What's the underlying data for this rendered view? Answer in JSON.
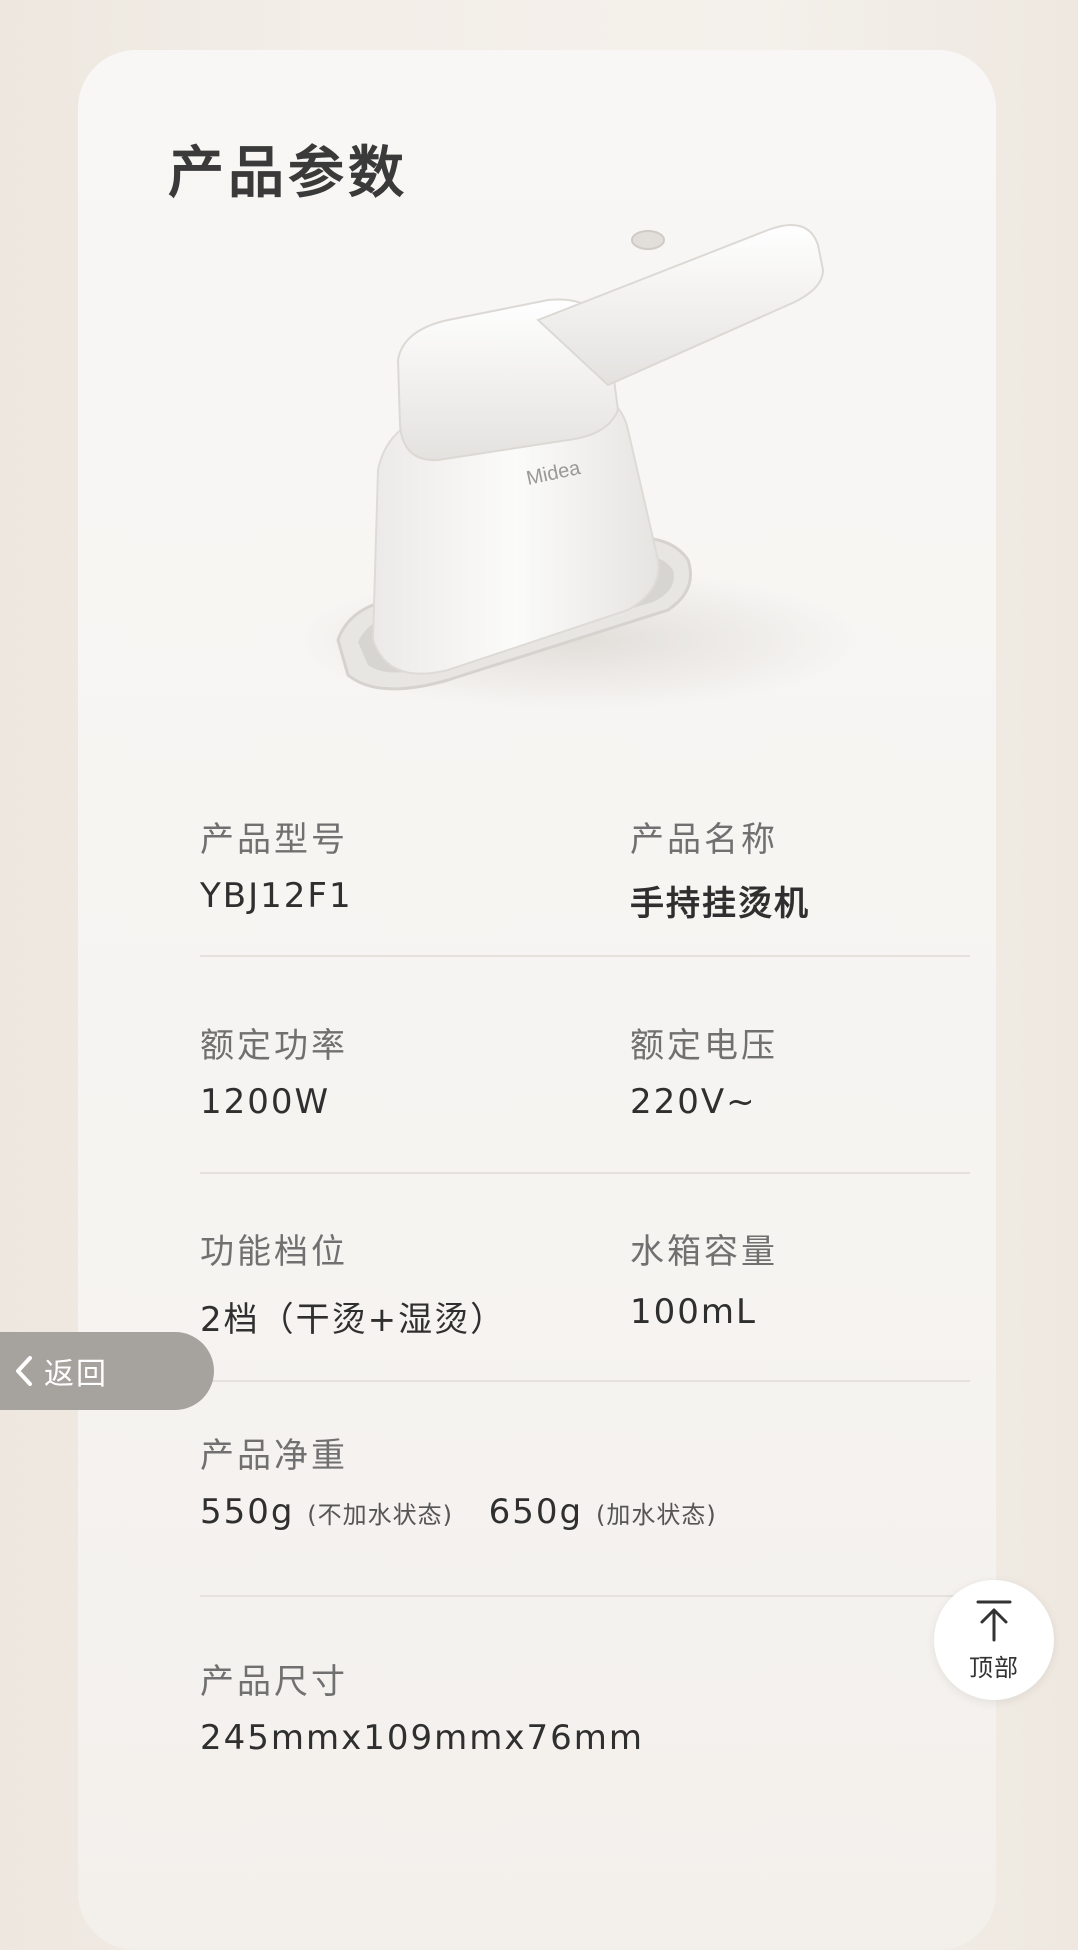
{
  "page": {
    "title": "产品参数"
  },
  "brand": {
    "logo_text": "Midea"
  },
  "specs": {
    "model": {
      "label": "产品型号",
      "value": "YBJ12F1"
    },
    "name": {
      "label": "产品名称",
      "value": "手持挂烫机"
    },
    "power": {
      "label": "额定功率",
      "value": "1200W"
    },
    "voltage": {
      "label": "额定电压",
      "value": "220V~"
    },
    "modes": {
      "label": "功能档位",
      "value": "2档（干烫+湿烫）"
    },
    "tank": {
      "label": "水箱容量",
      "value": "100mL"
    },
    "weight": {
      "label": "产品净重",
      "dry_value": "550g",
      "dry_note": "(不加水状态)",
      "wet_value": "650g",
      "wet_note": "(加水状态)"
    },
    "size": {
      "label": "产品尺寸",
      "value": "245mmx109mmx76mm"
    }
  },
  "nav": {
    "back_label": "返回",
    "top_label": "顶部"
  },
  "colors": {
    "page_bg": "#f1ece6",
    "card_bg": "#f7f5f2",
    "back_button_bg": "#a6a29e"
  }
}
